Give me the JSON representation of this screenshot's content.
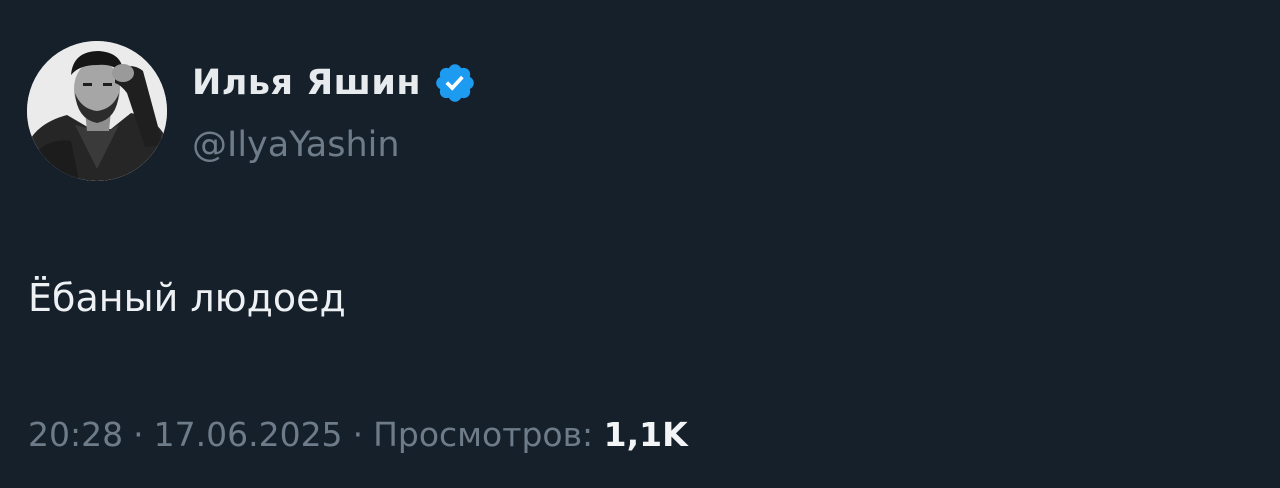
{
  "author": {
    "display_name": "Илья Яшин",
    "handle": "@IlyaYashin",
    "verified": true,
    "verified_color": "#1d9bf0"
  },
  "tweet": {
    "text": "Ёбаный людоед",
    "time": "20:28",
    "date": "17.06.2025",
    "views_label": "Просмотров:",
    "views_count": "1,1K",
    "separator": "·"
  },
  "colors": {
    "background": "#16202b",
    "primary_text": "#eef1f3",
    "secondary_text": "#6e7b89"
  },
  "icons": {
    "avatar": "profile-photo",
    "badge": "verified-badge-icon"
  }
}
